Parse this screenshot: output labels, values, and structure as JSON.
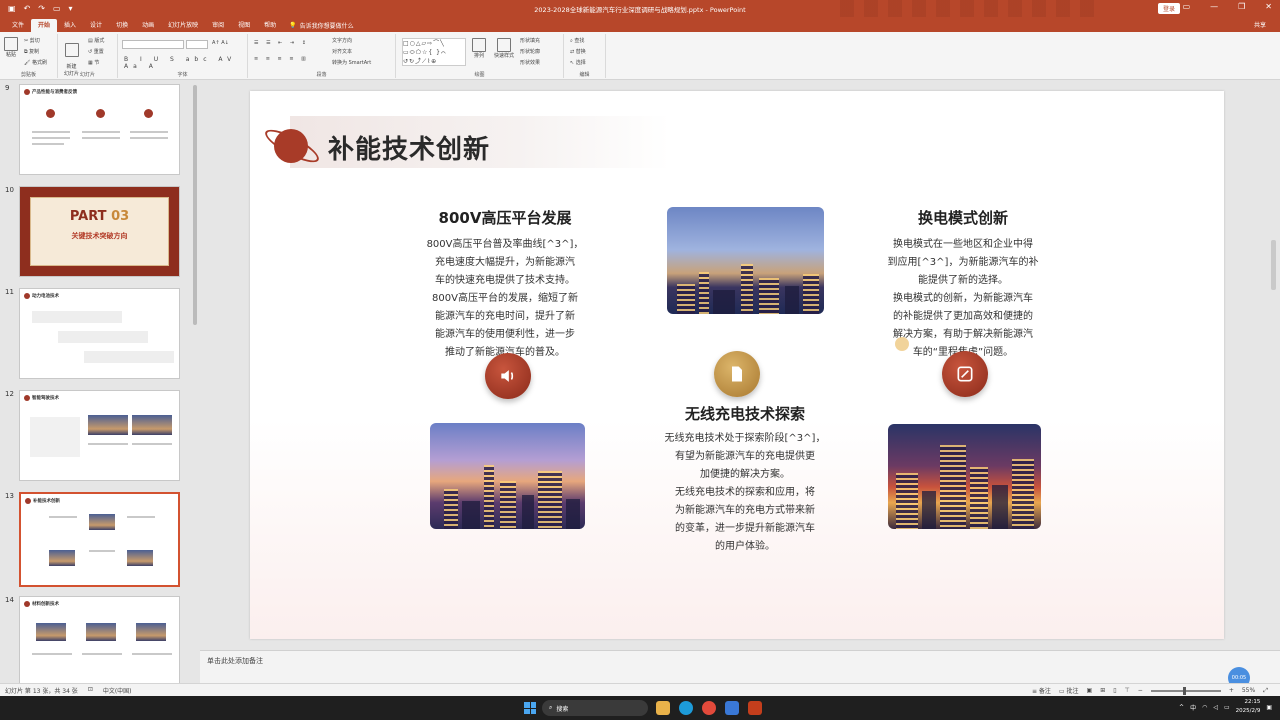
{
  "titlebar": {
    "doc_title": "2023-2028全球新能源汽车行业深度调研与战略规划.pptx - PowerPoint",
    "login": "登录",
    "qat_icons": [
      "save-icon",
      "undo-icon",
      "redo-icon",
      "present-icon",
      "customize-icon"
    ]
  },
  "menu": {
    "tabs": [
      "文件",
      "开始",
      "插入",
      "设计",
      "切换",
      "动画",
      "幻灯片放映",
      "审阅",
      "视图",
      "帮助"
    ],
    "active": "开始",
    "tell_me": "告诉我你想要做什么",
    "share": "共享"
  },
  "ribbon": {
    "groups": [
      "剪贴板",
      "幻灯片",
      "字体",
      "段落",
      "绘图",
      "编辑"
    ],
    "paste": "粘贴",
    "cut": "剪切",
    "copy": "复制",
    "format_painter": "格式刷",
    "new_slide": "新建\n幻灯片",
    "layout": "版式",
    "reset": "重置",
    "section": "节",
    "text_direction": "文字方向",
    "align_text": "对齐文本",
    "smartart": "转换为 SmartArt",
    "arrange": "排列",
    "quick_styles": "快速样式",
    "shape_fill": "形状填充",
    "shape_outline": "形状轮廓",
    "shape_effects": "形状效果",
    "find": "查找",
    "replace": "替换",
    "select": "选择"
  },
  "thumbnails": [
    {
      "num": "9",
      "title": "产品性能与消费者反馈"
    },
    {
      "num": "10",
      "part": "PART",
      "part_num": "03",
      "sub": "关键技术突破方向"
    },
    {
      "num": "11",
      "title": "动力电池技术"
    },
    {
      "num": "12",
      "title": "智能驾驶技术"
    },
    {
      "num": "13",
      "title": "补能技术创新"
    },
    {
      "num": "14",
      "title": "材料创新技术"
    }
  ],
  "slide": {
    "title": "补能技术创新",
    "blocks": [
      {
        "heading": "800V高压平台发展",
        "lines": [
          "800V高压平台普及率曲线[^3^]，",
          "充电速度大幅提升，为新能源汽",
          "车的快速充电提供了技术支持。",
          "800V高压平台的发展，缩短了新",
          "能源汽车的充电时间，提升了新",
          "能源汽车的使用便利性，进一步",
          "推动了新能源汽车的普及。"
        ]
      },
      {
        "heading": "换电模式创新",
        "lines": [
          "换电模式在一些地区和企业中得",
          "到应用[^3^]，为新能源汽车的补",
          "能提供了新的选择。",
          "换电模式的创新，为新能源汽车",
          "的补能提供了更加高效和便捷的",
          "解决方案，有助于解决新能源汽",
          "车的“里程焦虑”问题。"
        ]
      },
      {
        "heading": "无线充电技术探索",
        "lines": [
          "无线充电技术处于探索阶段[^3^]，",
          "有望为新能源汽车的充电提供更",
          "加便捷的解决方案。",
          "无线充电技术的探索和应用，将",
          "为新能源汽车的充电方式带来新",
          "的变革，进一步提升新能源汽车",
          "的用户体验。"
        ]
      }
    ],
    "badges": [
      "speaker-icon",
      "document-icon",
      "edit-icon"
    ]
  },
  "notes": {
    "placeholder": "单击此处添加备注",
    "recorder": "00:05"
  },
  "status": {
    "slide_info": "幻灯片 第 13 张，共 34 张",
    "language": "中文(中国)",
    "notes_btn": "备注",
    "comments_btn": "批注",
    "zoom": "55%"
  },
  "taskbar": {
    "search": "搜索",
    "time": "22:15",
    "date": "2025/2/9",
    "lang": "中"
  }
}
